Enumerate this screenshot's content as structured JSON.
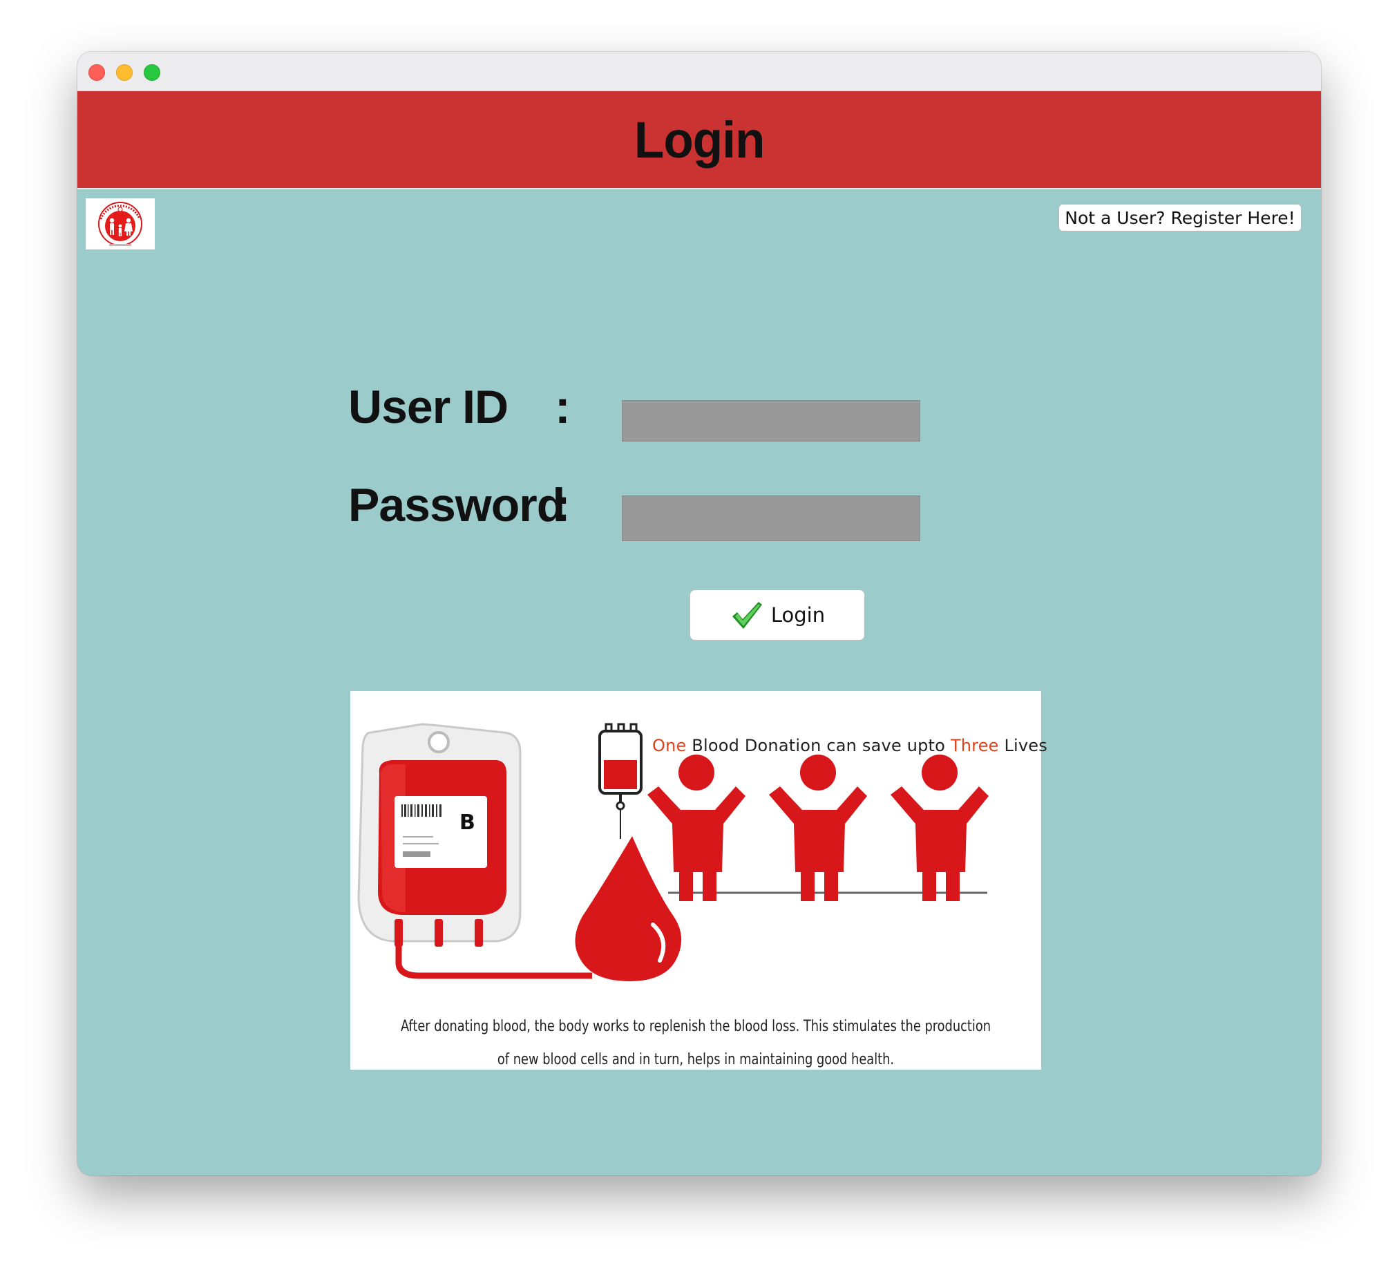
{
  "window": {
    "header_title": "Login"
  },
  "toolbar": {
    "register_label": "Not a User? Register Here!"
  },
  "form": {
    "user_id_label": "User ID",
    "password_label": "Password",
    "colon": ":",
    "user_id_value": "",
    "password_value": "",
    "login_button_label": "Login"
  },
  "banner": {
    "headline_part1": "One",
    "headline_part2": " Blood Donation can save upto ",
    "headline_part3": "Three",
    "headline_part4": " Lives",
    "blood_type": "B",
    "caption": "After donating blood, the body works to replenish the blood loss. This stimulates the production of new blood cells and in turn, helps in maintaining good health."
  },
  "colors": {
    "header": "#cb3332",
    "background": "#9ccbcb",
    "field": "#999999",
    "highlight": "#e0411b",
    "blood": "#d8171b"
  },
  "icons": {
    "login_icon": "green-check-icon",
    "logo": "national-health-mission-logo"
  }
}
